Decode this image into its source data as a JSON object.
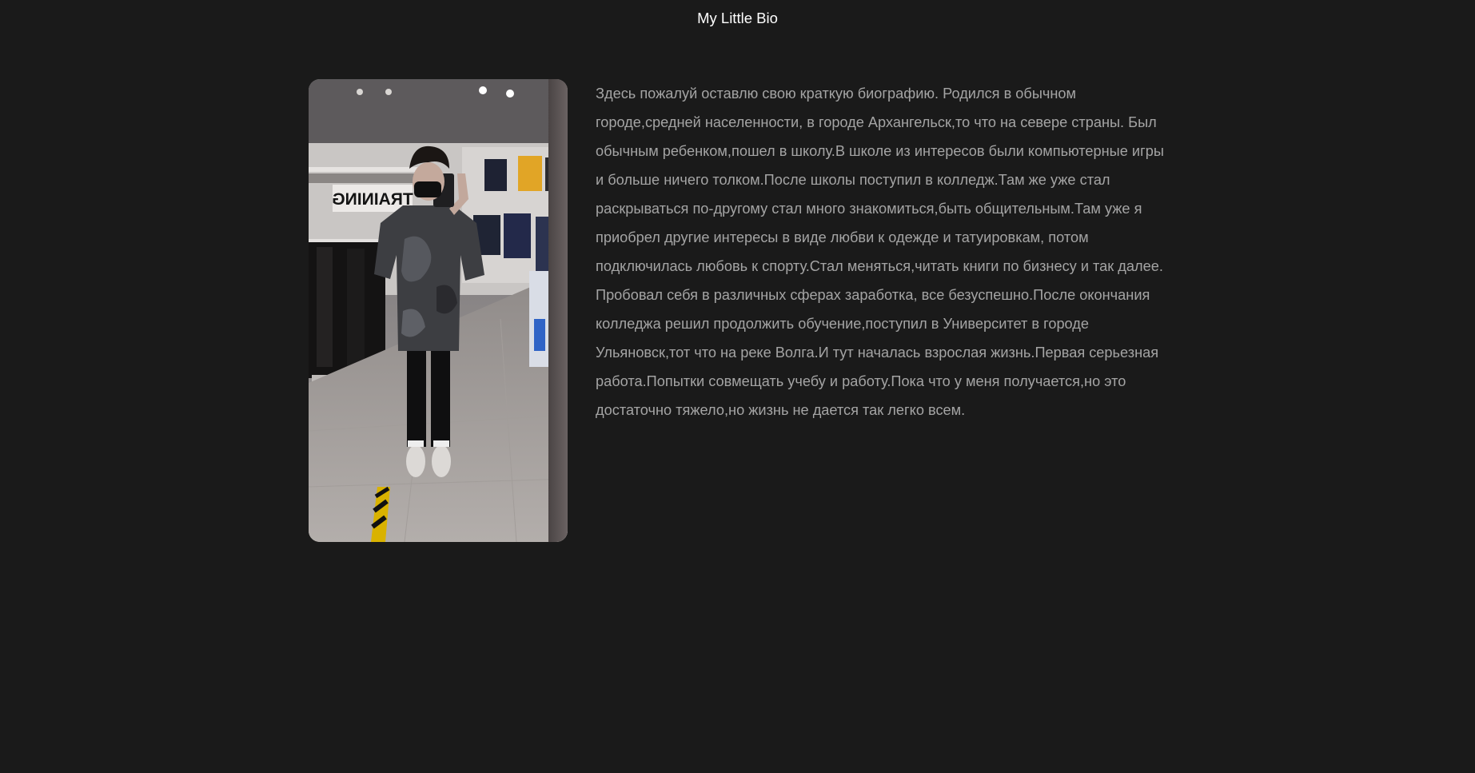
{
  "page": {
    "title": "My Little Bio",
    "background": "#1a1a1a",
    "title_color": "#ffffff",
    "text_color": "#a4a4a4"
  },
  "photo": {
    "description": "profile-photo",
    "sign_text": "TRAINING"
  },
  "bio": {
    "text": "Здесь пожалуй оставлю свою краткую биографию. Родился в обычном городе,средней населенности, в городе Архангельск,то что на севере страны. Был обычным ребенком,пошел в школу.В школе из интересов были компьютерные игры и больше ничего толком.После школы поступил в колледж.Там же уже стал раскрываться по-другому стал много знакомиться,быть общительным.Там уже я приобрел другие интересы в виде любви к одежде и татуировкам, потом подключилась любовь к спорту.Стал меняться,читать книги по бизнесу и так далее. Пробовал себя в различных сферах заработка, все безуспешно.После окончания колледжа решил продолжить обучение,поступил в Университет в городе Ульяновск,тот что на реке Волга.И тут началась взрослая жизнь.Первая серьезная работа.Попытки совмещать учебу и работу.Пока что у меня получается,но это достаточно тяжело,но жизнь не дается так легко всем."
  }
}
